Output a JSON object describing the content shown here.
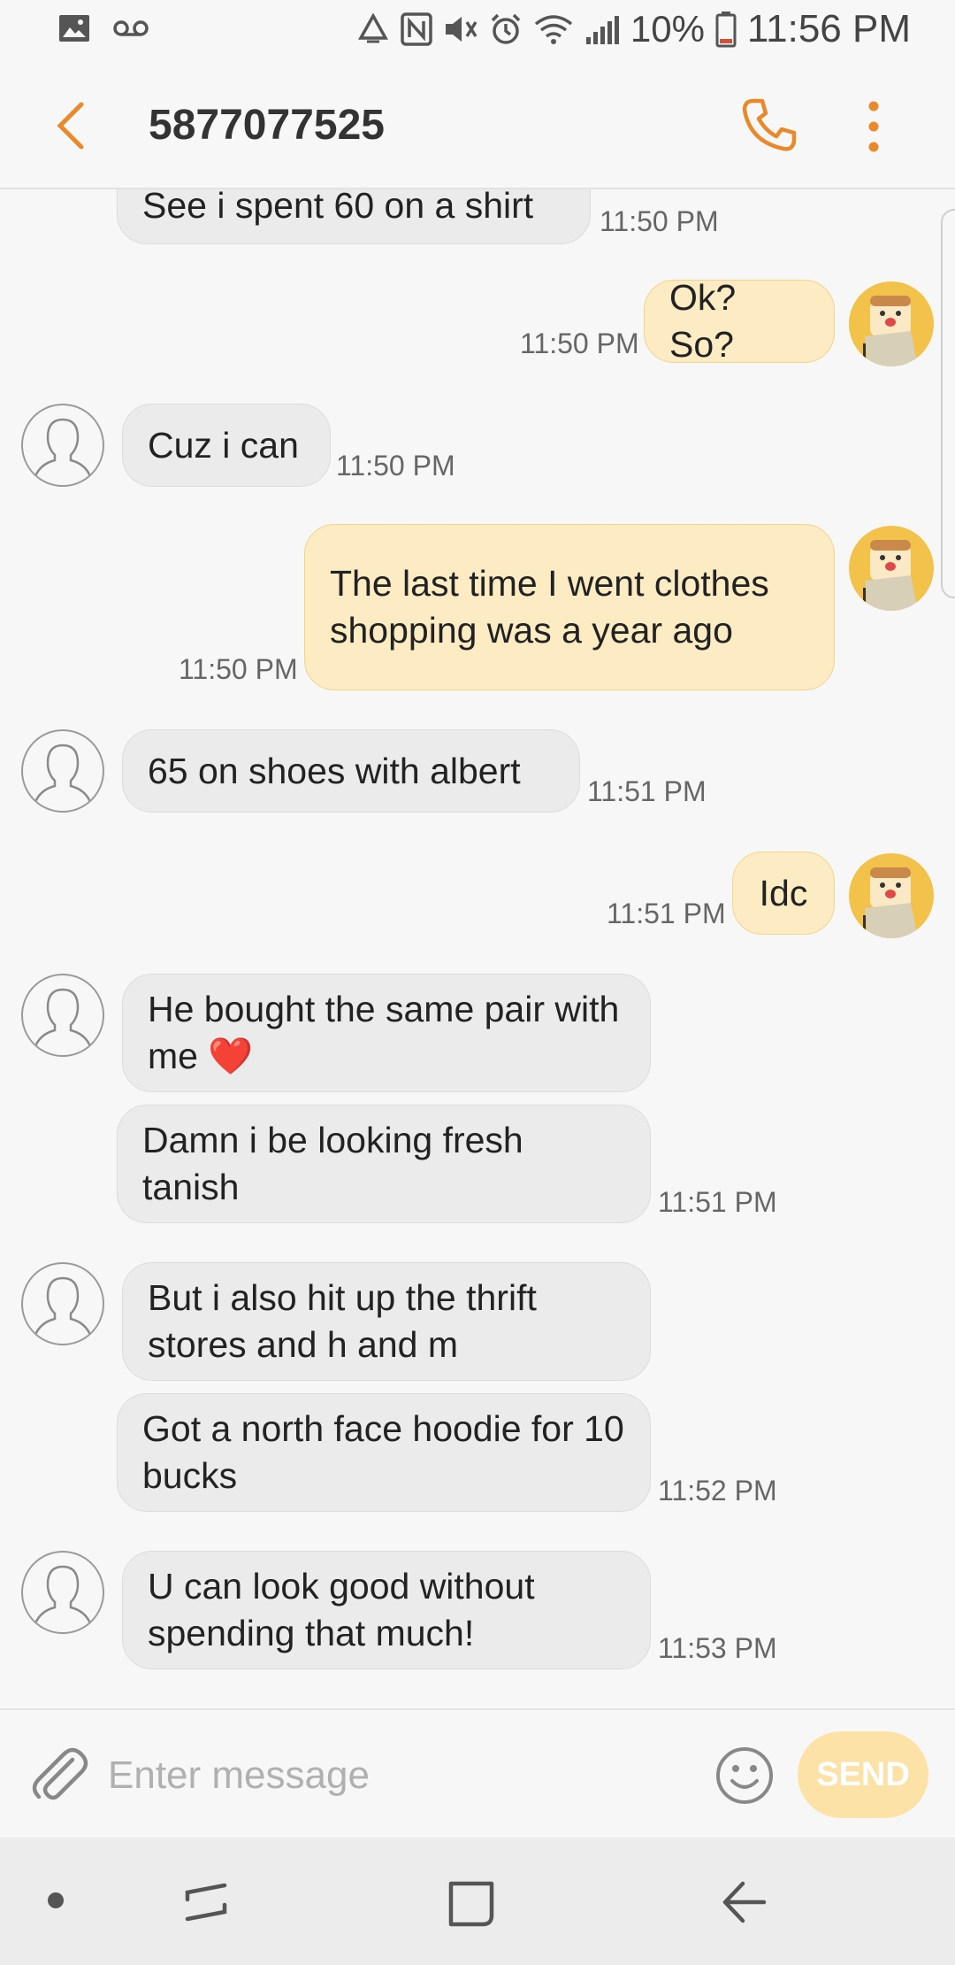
{
  "status_bar": {
    "battery": "10%",
    "time": "11:56 PM",
    "icons": [
      "gallery-icon",
      "voicemail-icon",
      "recycle-icon",
      "nfc-icon",
      "mute-icon",
      "alarm-icon",
      "wifi-icon",
      "signal-icon",
      "battery-icon"
    ]
  },
  "header": {
    "contact": "5877077525",
    "icons": [
      "back-arrow-icon",
      "phone-icon",
      "more-vert-icon"
    ]
  },
  "colors": {
    "accent": "#e8892b",
    "incoming_bubble": "#ebebeb",
    "outgoing_bubble": "#fdebc3",
    "send_button": "#fde2a8"
  },
  "messages": [
    {
      "dir": "in",
      "text": "See i spent 60 on a shirt",
      "time": "11:50 PM"
    },
    {
      "dir": "out",
      "text": "Ok? So?",
      "time": "11:50 PM"
    },
    {
      "dir": "in",
      "text": "Cuz i can",
      "time": "11:50 PM"
    },
    {
      "dir": "out",
      "text": "The last time I went clothes shopping was a year ago",
      "time": "11:50 PM"
    },
    {
      "dir": "in",
      "text": "65 on shoes with albert",
      "time": "11:51 PM"
    },
    {
      "dir": "out",
      "text": "Idc",
      "time": "11:51 PM"
    },
    {
      "dir": "in",
      "text": "He bought the same pair with me ❤️",
      "time": ""
    },
    {
      "dir": "in",
      "text": "Damn i be looking fresh tanish",
      "time": "11:51 PM"
    },
    {
      "dir": "in",
      "text": "But i also hit up the thrift stores and h and m",
      "time": ""
    },
    {
      "dir": "in",
      "text": "Got a north face hoodie for 10 bucks",
      "time": "11:52 PM"
    },
    {
      "dir": "in",
      "text": "U can look good without spending that much!",
      "time": "11:53 PM"
    }
  ],
  "composer": {
    "placeholder": "Enter message",
    "send_label": "SEND"
  }
}
